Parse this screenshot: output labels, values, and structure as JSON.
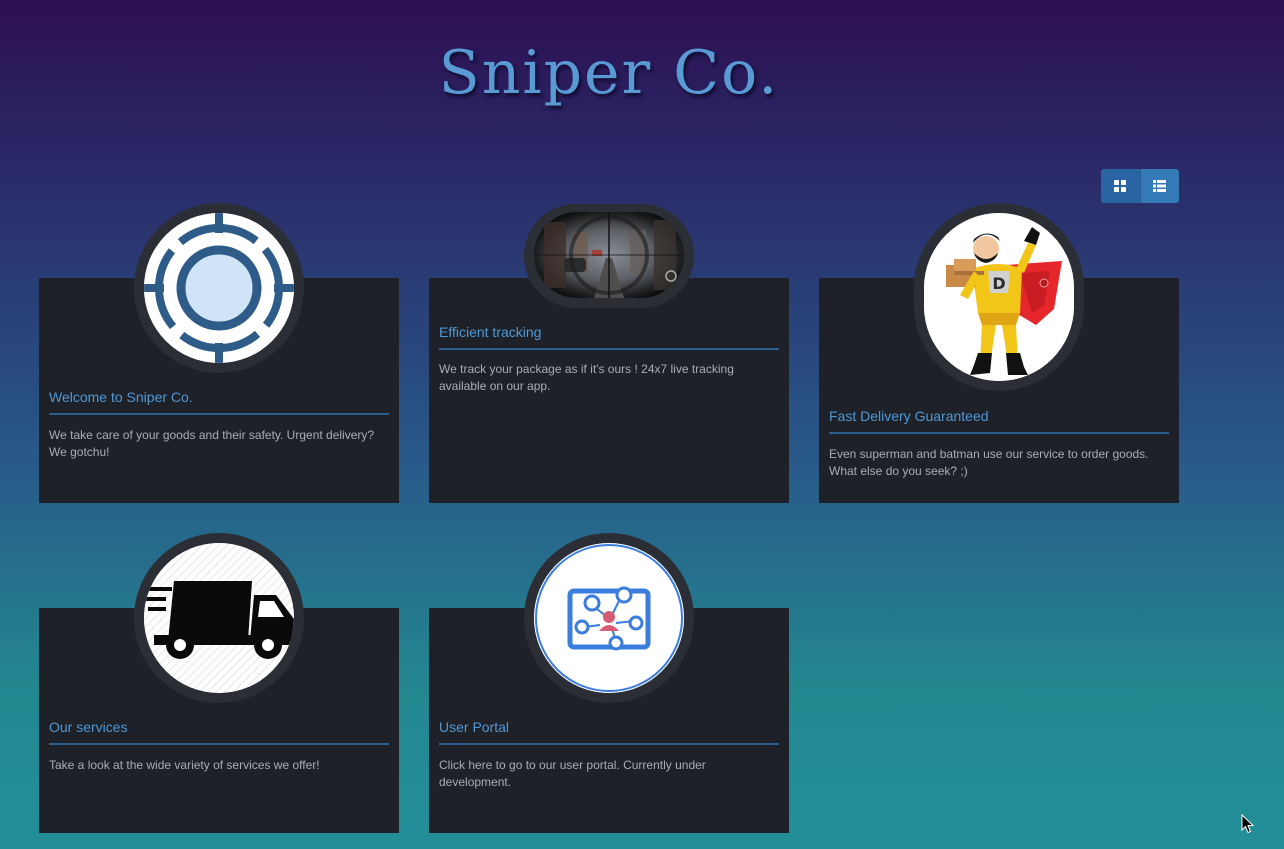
{
  "header": {
    "title": "Sniper Co."
  },
  "view_toggle": {
    "active": "grid",
    "grid_icon": "th-large-icon",
    "list_icon": "th-list-icon"
  },
  "colors": {
    "accent": "#4f98d6",
    "card_bg": "#1e2127",
    "toggle": "#337ab7"
  },
  "cards": [
    {
      "title": "Welcome to Sniper Co.",
      "text": "We take care of your goods and their safety. Urgent delivery? We gotchu!",
      "icon": "crosshair-icon"
    },
    {
      "title": "Efficient tracking",
      "text": "We track your package as if it's ours ! 24x7 live tracking available on our app.",
      "icon": "scope-view-image"
    },
    {
      "title": "Fast Delivery Guaranteed",
      "text": "Even superman and batman use our service to order goods. What else do you seek? ;)",
      "icon": "superhero-delivery-image"
    },
    {
      "title": "Our services",
      "text": "Take a look at the wide variety of services we offer!",
      "icon": "delivery-truck-icon"
    },
    {
      "title": "User Portal",
      "text": "Click here to go to our user portal. Currently under development.",
      "icon": "user-portal-icon"
    }
  ]
}
